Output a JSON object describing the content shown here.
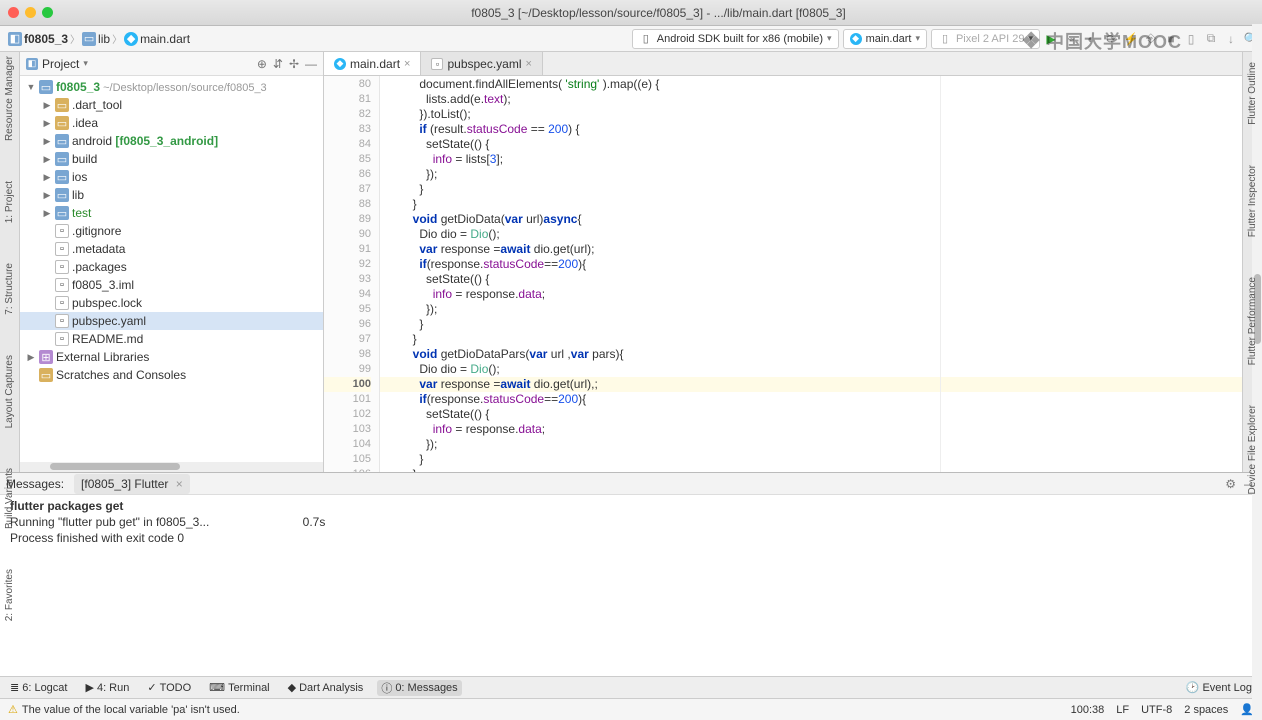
{
  "window": {
    "title": "f0805_3 [~/Desktop/lesson/source/f0805_3] - .../lib/main.dart [f0805_3]"
  },
  "breadcrumb": {
    "project": "f0805_3",
    "folder": "lib",
    "file": "main.dart"
  },
  "toolbar": {
    "device": "Android SDK built for x86 (mobile)",
    "run_config": "main.dart",
    "emulator": "Pixel 2 API 29"
  },
  "watermark": "中国大学MOOC",
  "project_panel": {
    "title": "Project",
    "tree": [
      {
        "depth": 0,
        "arrow": "▼",
        "icon": "folder",
        "label": "f0805_3",
        "suffix": " ~/Desktop/lesson/source/f0805_3",
        "bold": true
      },
      {
        "depth": 1,
        "arrow": "▶",
        "icon": "folder-y",
        "label": ".dart_tool"
      },
      {
        "depth": 1,
        "arrow": "▶",
        "icon": "folder-y",
        "label": ".idea"
      },
      {
        "depth": 1,
        "arrow": "▶",
        "icon": "folder",
        "label": "android",
        "suffix": " [f0805_3_android]",
        "boldSuffix": true
      },
      {
        "depth": 1,
        "arrow": "▶",
        "icon": "folder",
        "label": "build"
      },
      {
        "depth": 1,
        "arrow": "▶",
        "icon": "folder",
        "label": "ios"
      },
      {
        "depth": 1,
        "arrow": "▶",
        "icon": "folder",
        "label": "lib"
      },
      {
        "depth": 1,
        "arrow": "▶",
        "icon": "folder",
        "label": "test",
        "green": true
      },
      {
        "depth": 1,
        "arrow": "",
        "icon": "file",
        "label": ".gitignore"
      },
      {
        "depth": 1,
        "arrow": "",
        "icon": "file",
        "label": ".metadata"
      },
      {
        "depth": 1,
        "arrow": "",
        "icon": "file",
        "label": ".packages"
      },
      {
        "depth": 1,
        "arrow": "",
        "icon": "file",
        "label": "f0805_3.iml"
      },
      {
        "depth": 1,
        "arrow": "",
        "icon": "file",
        "label": "pubspec.lock"
      },
      {
        "depth": 1,
        "arrow": "",
        "icon": "file",
        "label": "pubspec.yaml",
        "selected": true
      },
      {
        "depth": 1,
        "arrow": "",
        "icon": "file",
        "label": "README.md"
      },
      {
        "depth": 0,
        "arrow": "▶",
        "icon": "lib",
        "label": "External Libraries"
      },
      {
        "depth": 0,
        "arrow": "",
        "icon": "folder-y",
        "label": "Scratches and Consoles"
      }
    ]
  },
  "editor": {
    "tabs": [
      {
        "icon": "dart",
        "label": "main.dart",
        "active": true
      },
      {
        "icon": "file",
        "label": "pubspec.yaml",
        "active": false
      }
    ],
    "first_line": 80,
    "current_line": 100,
    "lines": [
      {
        "indent": 5,
        "tokens": [
          {
            "t": "document.findAllElements( "
          },
          {
            "t": "'string'",
            "c": "str"
          },
          {
            "t": " ).map((e) {"
          }
        ]
      },
      {
        "indent": 6,
        "tokens": [
          {
            "t": "lists.add(e."
          },
          {
            "t": "text",
            "c": "prop"
          },
          {
            "t": ");"
          }
        ]
      },
      {
        "indent": 5,
        "tokens": [
          {
            "t": "}).toList();"
          }
        ]
      },
      {
        "indent": 5,
        "tokens": [
          {
            "t": "if ",
            "c": "kw"
          },
          {
            "t": "(result."
          },
          {
            "t": "statusCode",
            "c": "prop"
          },
          {
            "t": " == "
          },
          {
            "t": "200",
            "c": "num"
          },
          {
            "t": ") {"
          }
        ]
      },
      {
        "indent": 6,
        "tokens": [
          {
            "t": "setState(() {"
          }
        ]
      },
      {
        "indent": 7,
        "tokens": [
          {
            "t": "info",
            "c": "prop"
          },
          {
            "t": " = lists["
          },
          {
            "t": "3",
            "c": "num"
          },
          {
            "t": "];"
          }
        ]
      },
      {
        "indent": 6,
        "tokens": [
          {
            "t": "});"
          }
        ]
      },
      {
        "indent": 5,
        "tokens": [
          {
            "t": "}"
          }
        ]
      },
      {
        "indent": 4,
        "tokens": [
          {
            "t": "}"
          }
        ]
      },
      {
        "indent": 4,
        "tokens": [
          {
            "t": "void ",
            "c": "kw"
          },
          {
            "t": "getDioData("
          },
          {
            "t": "var ",
            "c": "kw"
          },
          {
            "t": "url)"
          },
          {
            "t": "async",
            "c": "kw"
          },
          {
            "t": "{"
          }
        ]
      },
      {
        "indent": 5,
        "tokens": [
          {
            "t": "Dio dio = "
          },
          {
            "t": "Dio",
            "c": "cls"
          },
          {
            "t": "();"
          }
        ]
      },
      {
        "indent": 5,
        "tokens": [
          {
            "t": "var ",
            "c": "kw"
          },
          {
            "t": "response ="
          },
          {
            "t": "await ",
            "c": "kw"
          },
          {
            "t": "dio.get(url);"
          }
        ]
      },
      {
        "indent": 5,
        "tokens": [
          {
            "t": "if",
            "c": "kw"
          },
          {
            "t": "(response."
          },
          {
            "t": "statusCode",
            "c": "prop"
          },
          {
            "t": "=="
          },
          {
            "t": "200",
            "c": "num"
          },
          {
            "t": "){"
          }
        ]
      },
      {
        "indent": 6,
        "tokens": [
          {
            "t": "setState(() {"
          }
        ]
      },
      {
        "indent": 7,
        "tokens": [
          {
            "t": "info",
            "c": "prop"
          },
          {
            "t": " = response."
          },
          {
            "t": "data",
            "c": "prop"
          },
          {
            "t": ";"
          }
        ]
      },
      {
        "indent": 6,
        "tokens": [
          {
            "t": "});"
          }
        ]
      },
      {
        "indent": 5,
        "tokens": [
          {
            "t": "}"
          }
        ]
      },
      {
        "indent": 4,
        "tokens": [
          {
            "t": "}"
          }
        ]
      },
      {
        "indent": 4,
        "tokens": [
          {
            "t": "void ",
            "c": "kw"
          },
          {
            "t": "getDioDataPars("
          },
          {
            "t": "var ",
            "c": "kw"
          },
          {
            "t": "url ,"
          },
          {
            "t": "var ",
            "c": "kw"
          },
          {
            "t": "pars){"
          }
        ]
      },
      {
        "indent": 5,
        "tokens": [
          {
            "t": "Dio dio = "
          },
          {
            "t": "Dio",
            "c": "cls"
          },
          {
            "t": "();"
          }
        ]
      },
      {
        "indent": 5,
        "hl": true,
        "tokens": [
          {
            "t": "var ",
            "c": "kw"
          },
          {
            "t": "response ="
          },
          {
            "t": "await ",
            "c": "kw"
          },
          {
            "t": "dio.get(url),;"
          }
        ]
      },
      {
        "indent": 5,
        "tokens": [
          {
            "t": "if",
            "c": "kw"
          },
          {
            "t": "(response."
          },
          {
            "t": "statusCode",
            "c": "prop"
          },
          {
            "t": "=="
          },
          {
            "t": "200",
            "c": "num"
          },
          {
            "t": "){"
          }
        ]
      },
      {
        "indent": 6,
        "tokens": [
          {
            "t": "setState(() {"
          }
        ]
      },
      {
        "indent": 7,
        "tokens": [
          {
            "t": "info",
            "c": "prop"
          },
          {
            "t": " = response."
          },
          {
            "t": "data",
            "c": "prop"
          },
          {
            "t": ";"
          }
        ]
      },
      {
        "indent": 6,
        "tokens": [
          {
            "t": "});"
          }
        ]
      },
      {
        "indent": 5,
        "tokens": [
          {
            "t": "}"
          }
        ]
      },
      {
        "indent": 4,
        "tokens": [
          {
            "t": "}"
          }
        ]
      }
    ]
  },
  "left_tabs": [
    "Resource Manager",
    "1: Project",
    "7: Structure",
    "Layout Captures",
    "Build Variants",
    "2: Favorites"
  ],
  "right_tabs": [
    "Flutter Outline",
    "Flutter Inspector",
    "Flutter Performance",
    "Device File Explorer"
  ],
  "messages": {
    "header_label": "Messages:",
    "tab": "[f0805_3] Flutter",
    "lines": [
      {
        "text": "flutter packages get",
        "bold": true
      },
      {
        "text": "Running \"flutter pub get\" in f0805_3...                            0.7s"
      },
      {
        "text": "Process finished with exit code 0"
      }
    ]
  },
  "bottom_tabs": {
    "items": [
      "6: Logcat",
      "4: Run",
      "TODO",
      "Terminal",
      "Dart Analysis",
      "0: Messages"
    ],
    "active": "0: Messages",
    "event_log": "Event Log"
  },
  "status": {
    "message": "The value of the local variable 'pa' isn't used.",
    "pos": "100:38",
    "lf": "LF",
    "enc": "UTF-8",
    "indent": "2 spaces"
  }
}
